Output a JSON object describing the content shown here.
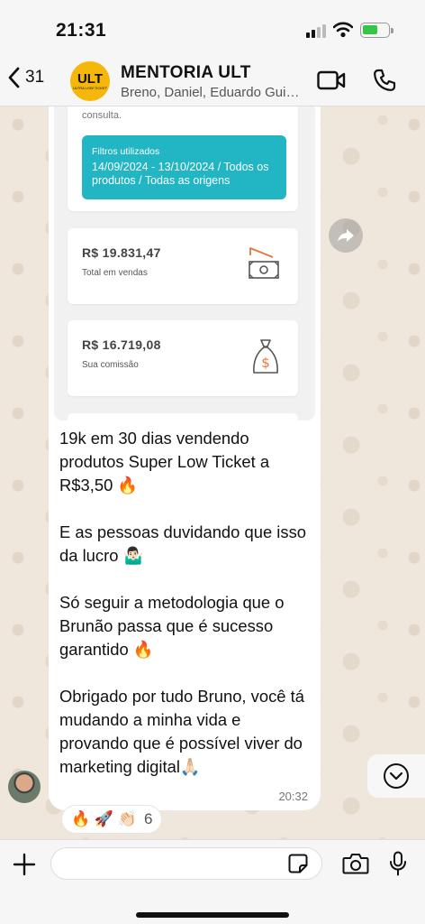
{
  "status_bar": {
    "time": "21:31"
  },
  "header": {
    "back_count": "31",
    "avatar_text": "ULT",
    "avatar_subtext": "ULTRA LOW TICKET",
    "title": "MENTORIA ULT",
    "subtitle": "Breno, Daniel, Eduardo Guim..."
  },
  "screenshot": {
    "consulta_text": "consulta.",
    "filters_label": "Filtros utilizados",
    "filters_value": "14/09/2024 - 13/10/2024 / Todos os produtos / Todas as origens",
    "total_sales_value": "R$ 19.831,47",
    "total_sales_label": "Total em vendas",
    "commission_value": "R$ 16.719,08",
    "commission_label": "Sua comissão"
  },
  "message": {
    "text": "19k em 30 dias vendendo produtos Super Low Ticket a R$3,50 🔥\n\nE as pessoas duvidando que isso da lucro 🤷🏻‍♂️\n\nSó seguir a metodologia que o Brunão passa que é sucesso garantido 🔥\n\nObrigado por tudo Bruno, você tá mudando a minha vida e provando que é possível viver do marketing digital🙏🏻",
    "time": "20:32"
  },
  "reactions": {
    "emojis": "🔥 🚀 👏🏻",
    "count": "6"
  },
  "input": {
    "placeholder": ""
  },
  "colors": {
    "accent": "#22b5c4",
    "avatar": "#f5b70a",
    "icon_orange": "#e0793a"
  }
}
